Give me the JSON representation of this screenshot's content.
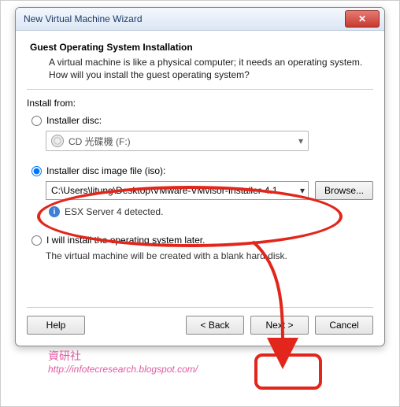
{
  "window": {
    "title": "New Virtual Machine Wizard"
  },
  "header": {
    "heading": "Guest Operating System Installation",
    "description": "A virtual machine is like a physical computer; it needs an operating system. How will you install the guest operating system?"
  },
  "install_from_label": "Install from:",
  "options": {
    "disc": {
      "label": "Installer disc:",
      "drive_text": "CD 光碟機 (F:)"
    },
    "iso": {
      "label": "Installer disc image file (iso):",
      "path": "C:\\Users\\litung\\Desktop\\VMware-VMvisor-Installer-4.1",
      "browse": "Browse...",
      "detected": "ESX Server 4 detected."
    },
    "later": {
      "label": "I will install the operating system later.",
      "note": "The virtual machine will be created with a blank hard disk."
    }
  },
  "buttons": {
    "help": "Help",
    "back": "< Back",
    "next": "Next >",
    "cancel": "Cancel"
  },
  "watermark": {
    "cn": "資研社",
    "url": "http://infotecresearch.blogspot.com/"
  }
}
